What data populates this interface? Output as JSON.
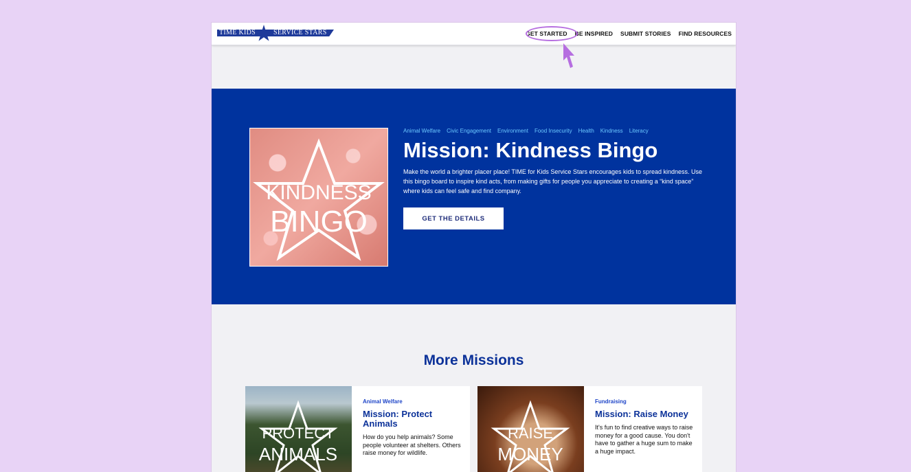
{
  "nav": {
    "logo_left": "TIME KIDS",
    "logo_right": "SERVICE STARS",
    "links": [
      "GET STARTED",
      "BE INSPIRED",
      "SUBMIT STORIES",
      "FIND RESOURCES"
    ]
  },
  "hero": {
    "image_text": [
      "KINDNESS",
      "BINGO"
    ],
    "tags": [
      "Animal Welfare",
      "Civic Engagement",
      "Environment",
      "Food Insecurity",
      "Health",
      "Kindness",
      "Literacy"
    ],
    "title": "Mission: Kindness Bingo",
    "description": "Make the world a brighter placer place! TIME for Kids Service Stars encourages kids to spread kindness. Use this bingo board to inspire kind acts, from making gifts for people you appreciate to creating a “kind space” where kids can feel safe and find company.",
    "button_label": "GET THE DETAILS"
  },
  "more": {
    "title": "More Missions",
    "cards": [
      {
        "image_text": [
          "PROTECT",
          "ANIMALS"
        ],
        "tag": "Animal Welfare",
        "title": "Mission: Protect Animals",
        "description": "How do you help animals? Some people volunteer at shelters. Others raise money for wildlife."
      },
      {
        "image_text": [
          "RAISE",
          "MONEY"
        ],
        "tag": "Fundraising",
        "title": "Mission: Raise Money",
        "description": "It's fun to find creative ways to raise money for a good cause. You don't have to gather a huge sum to make a huge impact."
      }
    ]
  },
  "colors": {
    "hero_bg": "#00339e",
    "accent_blue": "#0c3299",
    "tag_blue": "#6bc7ff",
    "annotation_purple": "#b66ee0",
    "backdrop": "#e8d3f6"
  }
}
